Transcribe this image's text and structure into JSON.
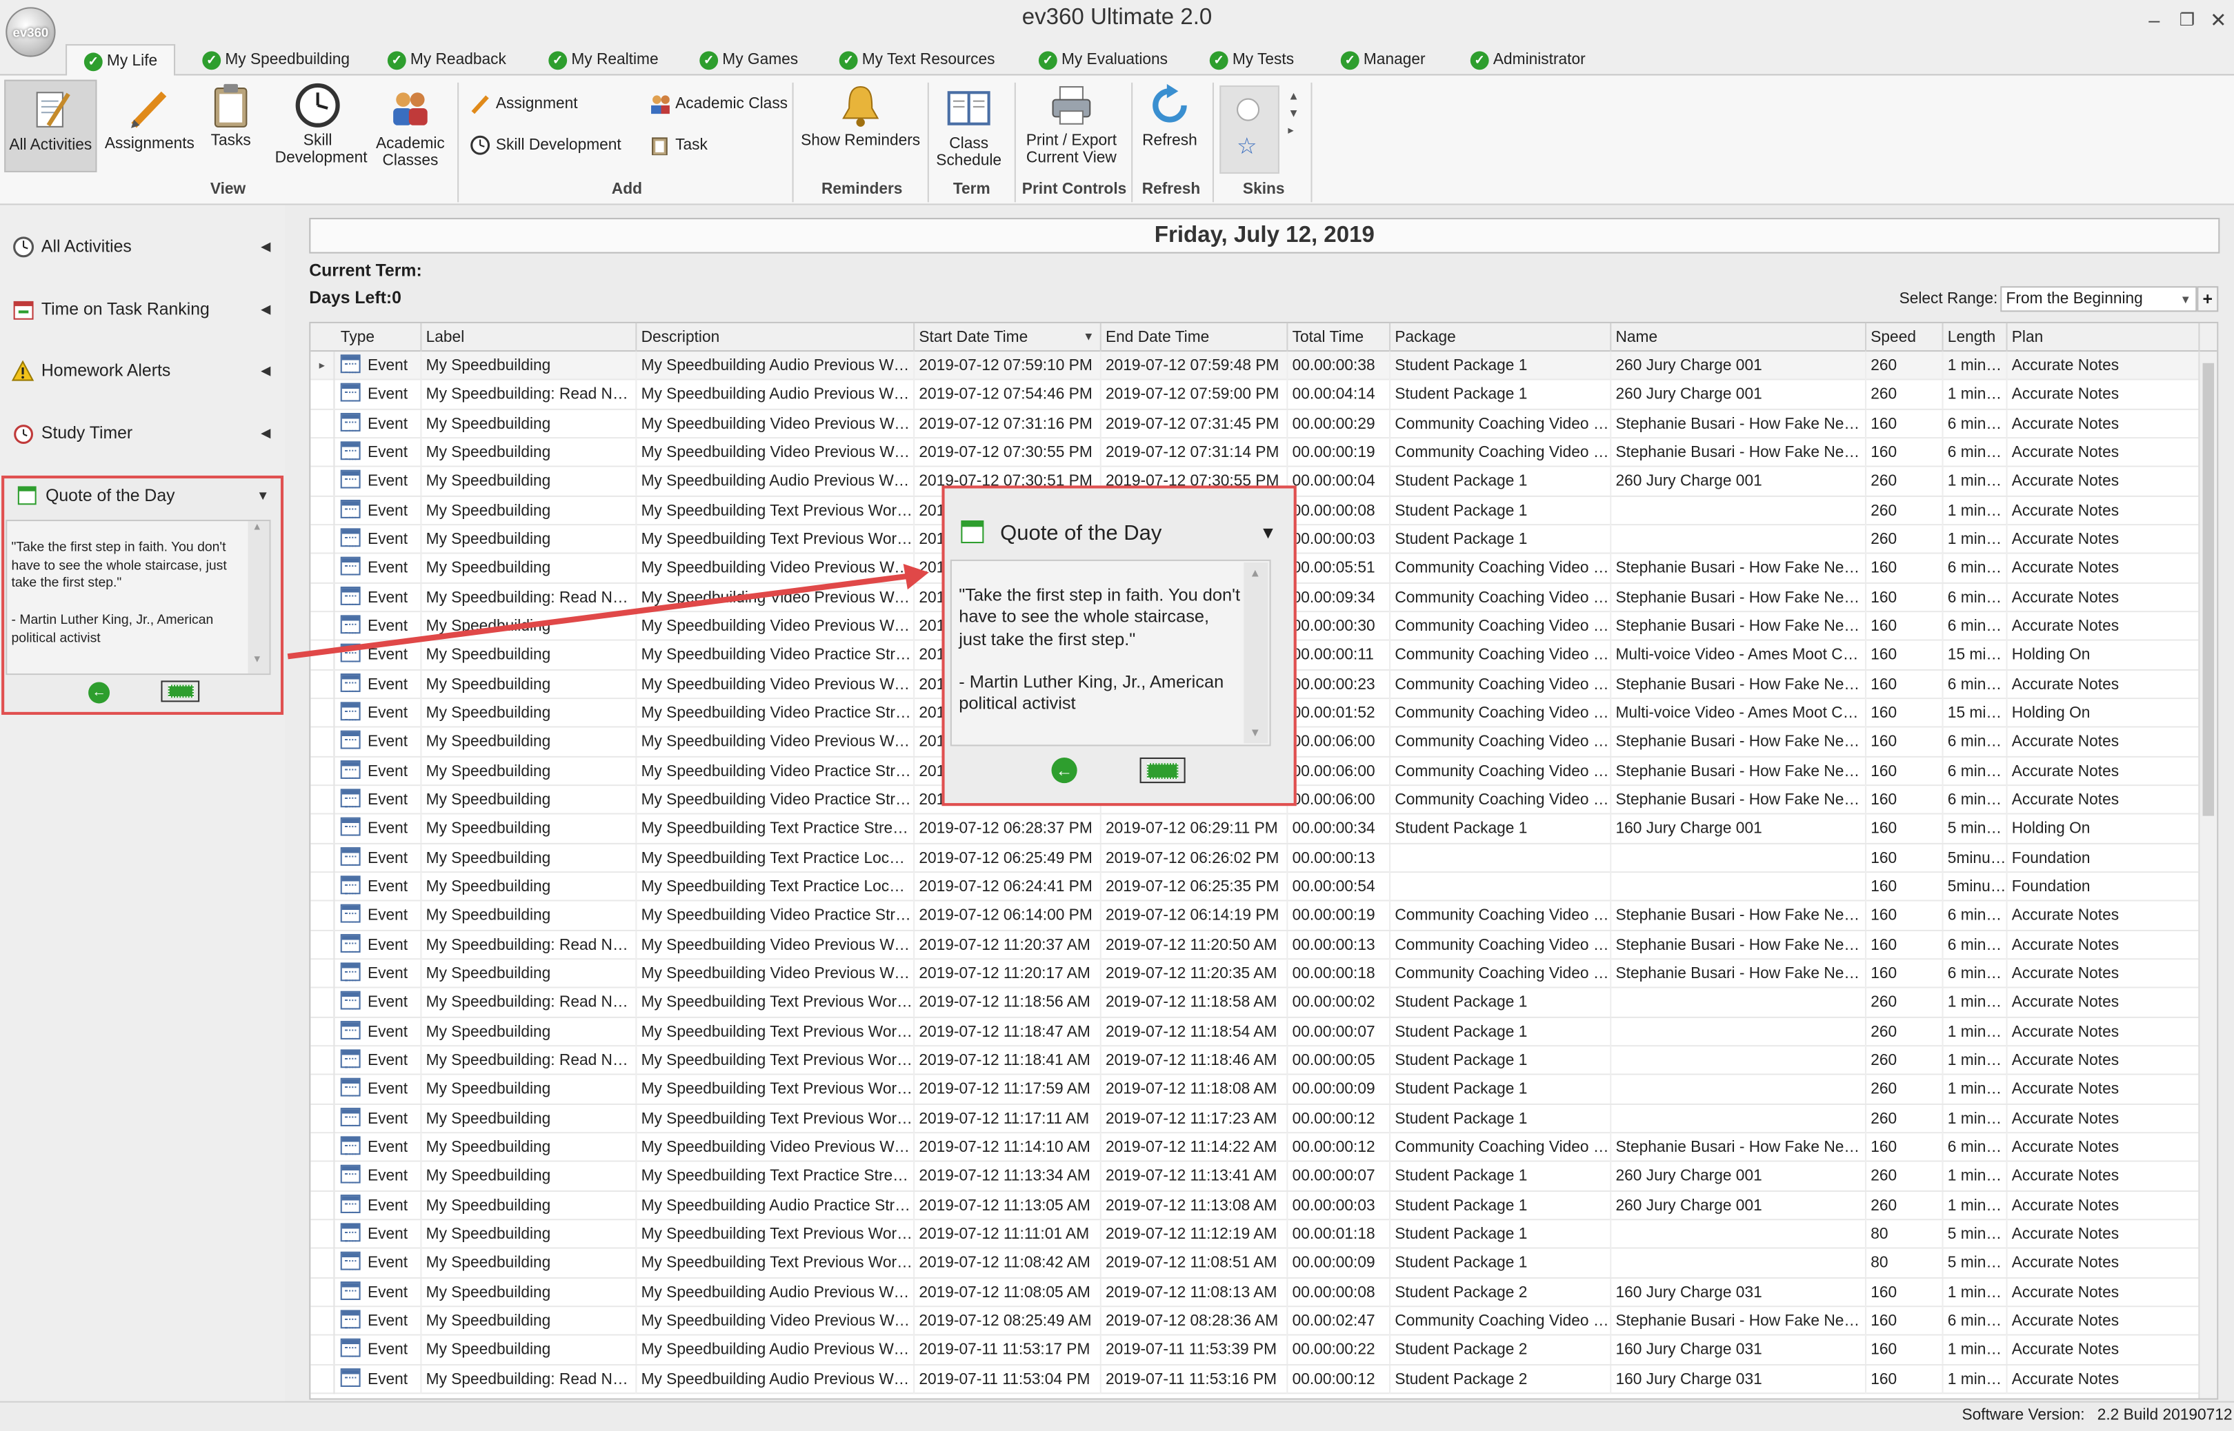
{
  "window": {
    "title": "ev360 Ultimate 2.0",
    "logo_text": "ev360"
  },
  "tabs": [
    {
      "label": "My Life",
      "active": true
    },
    {
      "label": "My Speedbuilding"
    },
    {
      "label": "My Readback"
    },
    {
      "label": "My Realtime"
    },
    {
      "label": "My Games"
    },
    {
      "label": "My Text Resources"
    },
    {
      "label": "My Evaluations"
    },
    {
      "label": "My Tests"
    },
    {
      "label": "Manager"
    },
    {
      "label": "Administrator"
    }
  ],
  "ribbon": {
    "view_buttons": [
      {
        "label": "All Activities",
        "icon": "notepad-pencil-icon"
      },
      {
        "label": "Assignments",
        "icon": "pencil-icon"
      },
      {
        "label": "Tasks",
        "icon": "clipboard-icon"
      },
      {
        "label": "Skill Development",
        "icon": "clock-icon"
      },
      {
        "label": "Academic Classes",
        "icon": "people-icon"
      }
    ],
    "add_buttons": [
      {
        "label": "Assignment",
        "icon": "pencil-icon"
      },
      {
        "label": "Academic Class",
        "icon": "people-icon"
      },
      {
        "label": "Skill Development",
        "icon": "clock-icon"
      },
      {
        "label": "Task",
        "icon": "clipboard-icon"
      }
    ],
    "reminders_button": {
      "label": "Show Reminders",
      "icon": "bell-icon"
    },
    "term_button": {
      "label": "Class Schedule",
      "icon": "book-icon"
    },
    "print_button": {
      "label": "Print / Export Current View",
      "icon": "printer-icon"
    },
    "refresh_button": {
      "label": "Refresh",
      "icon": "refresh-icon"
    },
    "groups": {
      "view": "View",
      "add": "Add",
      "reminders": "Reminders",
      "term": "Term",
      "print": "Print Controls",
      "refresh": "Refresh",
      "skins": "Skins"
    }
  },
  "sidebar": {
    "items": [
      {
        "label": "All Activities",
        "icon": "clock-icon"
      },
      {
        "label": "Time on Task Ranking",
        "icon": "calendar-icon"
      },
      {
        "label": "Homework Alerts",
        "icon": "warning-icon"
      },
      {
        "label": "Study Timer",
        "icon": "alarm-clock-icon"
      }
    ],
    "quote_title": "Quote of the Day"
  },
  "quote": {
    "title": "Quote of the Day",
    "text": "\"Take the first step in faith. You don't have to see the whole staircase, just take the first step.\"\n\n- Martin Luther King, Jr., American political activist"
  },
  "main": {
    "date": "Friday, July 12, 2019",
    "current_term_label": "Current Term:",
    "days_left_label": "Days Left:0",
    "select_range_label": "Select Range:",
    "select_range_value": "From the Beginning"
  },
  "grid": {
    "columns": [
      "Type",
      "Label",
      "Description",
      "Start Date Time",
      "End Date Time",
      "Total Time",
      "Package",
      "Name",
      "Speed",
      "Length",
      "Plan"
    ],
    "rows": [
      [
        "Event",
        "My Speedbuilding",
        "My Speedbuilding Audio Previous Wor...",
        "2019-07-12 07:59:10 PM",
        "2019-07-12 07:59:48 PM",
        "00.00:00:38",
        "Student Package 1",
        "260 Jury Charge 001",
        "260",
        "1 minute",
        "Accurate Notes"
      ],
      [
        "Event",
        "My Speedbuilding: Read Notes",
        "My Speedbuilding Audio Previous Wor...",
        "2019-07-12 07:54:46 PM",
        "2019-07-12 07:59:00 PM",
        "00.00:04:14",
        "Student Package 1",
        "260 Jury Charge 001",
        "260",
        "1 minute",
        "Accurate Notes"
      ],
      [
        "Event",
        "My Speedbuilding",
        "My Speedbuilding Video Previous Wor...",
        "2019-07-12 07:31:16 PM",
        "2019-07-12 07:31:45 PM",
        "00.00:00:29",
        "Community Coaching Video P...",
        "Stephanie Busari - How Fake New...",
        "160",
        "6 minutes",
        "Accurate Notes"
      ],
      [
        "Event",
        "My Speedbuilding",
        "My Speedbuilding Video Previous Wor...",
        "2019-07-12 07:30:55 PM",
        "2019-07-12 07:31:14 PM",
        "00.00:00:19",
        "Community Coaching Video P...",
        "Stephanie Busari - How Fake New...",
        "160",
        "6 minutes",
        "Accurate Notes"
      ],
      [
        "Event",
        "My Speedbuilding",
        "My Speedbuilding Audio Previous Wor...",
        "2019-07-12 07:30:51 PM",
        "2019-07-12 07:30:55 PM",
        "00.00:00:04",
        "Student Package 1",
        "260 Jury Charge 001",
        "260",
        "1 minute",
        "Accurate Notes"
      ],
      [
        "Event",
        "My Speedbuilding",
        "My Speedbuilding Text Previous Work...",
        "2019-07-12",
        "",
        "00.00:00:08",
        "Student Package 1",
        "",
        "260",
        "1 minute",
        "Accurate Notes"
      ],
      [
        "Event",
        "My Speedbuilding",
        "My Speedbuilding Text Previous Work...",
        "2019-07-12",
        "",
        "00.00:00:03",
        "Student Package 1",
        "",
        "260",
        "1 minute",
        "Accurate Notes"
      ],
      [
        "Event",
        "My Speedbuilding",
        "My Speedbuilding Video Previous Wor...",
        "2019-07-12",
        "",
        "00.00:05:51",
        "Community Coaching Video P...",
        "Stephanie Busari - How Fake New...",
        "160",
        "6 minutes",
        "Accurate Notes"
      ],
      [
        "Event",
        "My Speedbuilding: Read Notes",
        "My Speedbuilding Video Previous Wor...",
        "2019-07-12",
        "",
        "00.00:09:34",
        "Community Coaching Video P...",
        "Stephanie Busari - How Fake New...",
        "160",
        "6 minutes",
        "Accurate Notes"
      ],
      [
        "Event",
        "My Speedbuilding",
        "My Speedbuilding Video Previous Wor...",
        "2019-07-12",
        "",
        "00.00:00:30",
        "Community Coaching Video P...",
        "Stephanie Busari - How Fake New...",
        "160",
        "6 minutes",
        "Accurate Notes"
      ],
      [
        "Event",
        "My Speedbuilding",
        "My Speedbuilding Video Practice Stre...",
        "2019-07-12",
        "",
        "00.00:00:11",
        "Community Coaching Video P...",
        "Multi-voice Video - Ames Moot Cou...",
        "160",
        "15 minu...",
        "Holding On"
      ],
      [
        "Event",
        "My Speedbuilding",
        "My Speedbuilding Video Previous Wor...",
        "2019-07-12",
        "",
        "00.00:00:23",
        "Community Coaching Video P...",
        "Stephanie Busari - How Fake New...",
        "160",
        "6 minutes",
        "Accurate Notes"
      ],
      [
        "Event",
        "My Speedbuilding",
        "My Speedbuilding Video Practice Stre...",
        "2019-07-12",
        "",
        "00.00:01:52",
        "Community Coaching Video P...",
        "Multi-voice Video - Ames Moot Cou...",
        "160",
        "15 minu...",
        "Holding On"
      ],
      [
        "Event",
        "My Speedbuilding",
        "My Speedbuilding Video Previous Wor...",
        "2019-07-12",
        "",
        "00.00:06:00",
        "Community Coaching Video P...",
        "Stephanie Busari - How Fake New...",
        "160",
        "6 minutes",
        "Accurate Notes"
      ],
      [
        "Event",
        "My Speedbuilding",
        "My Speedbuilding Video Practice Stre...",
        "2019-07-12",
        "",
        "00.00:06:00",
        "Community Coaching Video P...",
        "Stephanie Busari - How Fake New...",
        "160",
        "6 minutes",
        "Accurate Notes"
      ],
      [
        "Event",
        "My Speedbuilding",
        "My Speedbuilding Video Practice Stre...",
        "2019-07-12",
        "",
        "00.00:06:00",
        "Community Coaching Video P...",
        "Stephanie Busari - How Fake New...",
        "160",
        "6 minutes",
        "Accurate Notes"
      ],
      [
        "Event",
        "My Speedbuilding",
        "My Speedbuilding Text Practice Strea...",
        "2019-07-12 06:28:37 PM",
        "2019-07-12 06:29:11 PM",
        "00.00:00:34",
        "Student Package 1",
        "160 Jury Charge 001",
        "160",
        "5 minutes",
        "Holding On"
      ],
      [
        "Event",
        "My Speedbuilding",
        "My Speedbuilding Text Practice Local ...",
        "2019-07-12 06:25:49 PM",
        "2019-07-12 06:26:02 PM",
        "00.00:00:13",
        "",
        "",
        "160",
        "5minutes",
        "Foundation"
      ],
      [
        "Event",
        "My Speedbuilding",
        "My Speedbuilding Text Practice Local ...",
        "2019-07-12 06:24:41 PM",
        "2019-07-12 06:25:35 PM",
        "00.00:00:54",
        "",
        "",
        "160",
        "5minutes",
        "Foundation"
      ],
      [
        "Event",
        "My Speedbuilding",
        "My Speedbuilding Video Practice Stre...",
        "2019-07-12 06:14:00 PM",
        "2019-07-12 06:14:19 PM",
        "00.00:00:19",
        "Community Coaching Video P...",
        "Stephanie Busari - How Fake New...",
        "160",
        "6 minutes",
        "Accurate Notes"
      ],
      [
        "Event",
        "My Speedbuilding: Read Notes",
        "My Speedbuilding Video Previous Wor...",
        "2019-07-12 11:20:37 AM",
        "2019-07-12 11:20:50 AM",
        "00.00:00:13",
        "Community Coaching Video P...",
        "Stephanie Busari - How Fake New...",
        "160",
        "6 minutes",
        "Accurate Notes"
      ],
      [
        "Event",
        "My Speedbuilding",
        "My Speedbuilding Video Previous Wor...",
        "2019-07-12 11:20:17 AM",
        "2019-07-12 11:20:35 AM",
        "00.00:00:18",
        "Community Coaching Video P...",
        "Stephanie Busari - How Fake New...",
        "160",
        "6 minutes",
        "Accurate Notes"
      ],
      [
        "Event",
        "My Speedbuilding: Read Notes",
        "My Speedbuilding Text Previous Work...",
        "2019-07-12 11:18:56 AM",
        "2019-07-12 11:18:58 AM",
        "00.00:00:02",
        "Student Package 1",
        "",
        "260",
        "1 minute",
        "Accurate Notes"
      ],
      [
        "Event",
        "My Speedbuilding",
        "My Speedbuilding Text Previous Work...",
        "2019-07-12 11:18:47 AM",
        "2019-07-12 11:18:54 AM",
        "00.00:00:07",
        "Student Package 1",
        "",
        "260",
        "1 minute",
        "Accurate Notes"
      ],
      [
        "Event",
        "My Speedbuilding: Read Notes",
        "My Speedbuilding Text Previous Work...",
        "2019-07-12 11:18:41 AM",
        "2019-07-12 11:18:46 AM",
        "00.00:00:05",
        "Student Package 1",
        "",
        "260",
        "1 minute",
        "Accurate Notes"
      ],
      [
        "Event",
        "My Speedbuilding",
        "My Speedbuilding Text Previous Work...",
        "2019-07-12 11:17:59 AM",
        "2019-07-12 11:18:08 AM",
        "00.00:00:09",
        "Student Package 1",
        "",
        "260",
        "1 minute",
        "Accurate Notes"
      ],
      [
        "Event",
        "My Speedbuilding",
        "My Speedbuilding Text Previous Work...",
        "2019-07-12 11:17:11 AM",
        "2019-07-12 11:17:23 AM",
        "00.00:00:12",
        "Student Package 1",
        "",
        "260",
        "1 minute",
        "Accurate Notes"
      ],
      [
        "Event",
        "My Speedbuilding",
        "My Speedbuilding Video Previous Wor...",
        "2019-07-12 11:14:10 AM",
        "2019-07-12 11:14:22 AM",
        "00.00:00:12",
        "Community Coaching Video P...",
        "Stephanie Busari - How Fake New...",
        "160",
        "6 minutes",
        "Accurate Notes"
      ],
      [
        "Event",
        "My Speedbuilding",
        "My Speedbuilding Text Practice Strea...",
        "2019-07-12 11:13:34 AM",
        "2019-07-12 11:13:41 AM",
        "00.00:00:07",
        "Student Package 1",
        "260 Jury Charge 001",
        "260",
        "1 minute",
        "Accurate Notes"
      ],
      [
        "Event",
        "My Speedbuilding",
        "My Speedbuilding Audio Practice Stre...",
        "2019-07-12 11:13:05 AM",
        "2019-07-12 11:13:08 AM",
        "00.00:00:03",
        "Student Package 1",
        "260 Jury Charge 001",
        "260",
        "1 minute",
        "Accurate Notes"
      ],
      [
        "Event",
        "My Speedbuilding",
        "My Speedbuilding Text Previous Work...",
        "2019-07-12 11:11:01 AM",
        "2019-07-12 11:12:19 AM",
        "00.00:01:18",
        "Student Package 1",
        "",
        "80",
        "5 minutes",
        "Accurate Notes"
      ],
      [
        "Event",
        "My Speedbuilding",
        "My Speedbuilding Text Previous Work...",
        "2019-07-12 11:08:42 AM",
        "2019-07-12 11:08:51 AM",
        "00.00:00:09",
        "Student Package 1",
        "",
        "80",
        "5 minutes",
        "Accurate Notes"
      ],
      [
        "Event",
        "My Speedbuilding",
        "My Speedbuilding Audio Previous Wor...",
        "2019-07-12 11:08:05 AM",
        "2019-07-12 11:08:13 AM",
        "00.00:00:08",
        "Student Package 2",
        "160 Jury Charge 031",
        "160",
        "1 minute",
        "Accurate Notes"
      ],
      [
        "Event",
        "My Speedbuilding",
        "My Speedbuilding Video Previous Wor...",
        "2019-07-12 08:25:49 AM",
        "2019-07-12 08:28:36 AM",
        "00.00:02:47",
        "Community Coaching Video P...",
        "Stephanie Busari - How Fake New...",
        "160",
        "6 minutes",
        "Accurate Notes"
      ],
      [
        "Event",
        "My Speedbuilding",
        "My Speedbuilding Audio Previous Wor...",
        "2019-07-11 11:53:17 PM",
        "2019-07-11 11:53:39 PM",
        "00.00:00:22",
        "Student Package 2",
        "160 Jury Charge 031",
        "160",
        "1 minute",
        "Accurate Notes"
      ],
      [
        "Event",
        "My Speedbuilding: Read Notes",
        "My Speedbuilding Audio Previous Wor...",
        "2019-07-11 11:53:04 PM",
        "2019-07-11 11:53:16 PM",
        "00.00:00:12",
        "Student Package 2",
        "160 Jury Charge 031",
        "160",
        "1 minute",
        "Accurate Notes"
      ]
    ]
  },
  "status": {
    "version_label": "Software Version:",
    "version_value": "2.2 Build 20190712"
  },
  "colors": {
    "highlight_border": "#e05050",
    "arrow": "#e04848",
    "check_green": "#2e9e2e"
  }
}
